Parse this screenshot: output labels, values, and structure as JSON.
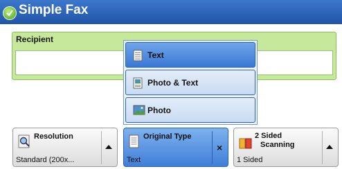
{
  "title": "Simple Fax",
  "recipient": {
    "label": "Recipient"
  },
  "buttons": {
    "resolution": {
      "label": "Resolution",
      "value": "Standard (200x..."
    },
    "original_type": {
      "label": "Original Type",
      "value": "Text"
    },
    "scanning": {
      "label_line1": "2 Sided",
      "label_line2": "Scanning",
      "value": "1 Sided"
    }
  },
  "dropdown": {
    "options": [
      {
        "label": "Text",
        "icon": "text-document-icon"
      },
      {
        "label": "Photo & Text",
        "icon": "photo-text-icon"
      },
      {
        "label": "Photo",
        "icon": "photo-icon"
      }
    ]
  },
  "colors": {
    "titlebar": "#2b63b8",
    "recipient_panel": "#c6e89a",
    "selected_blue": "#4a86dc"
  }
}
